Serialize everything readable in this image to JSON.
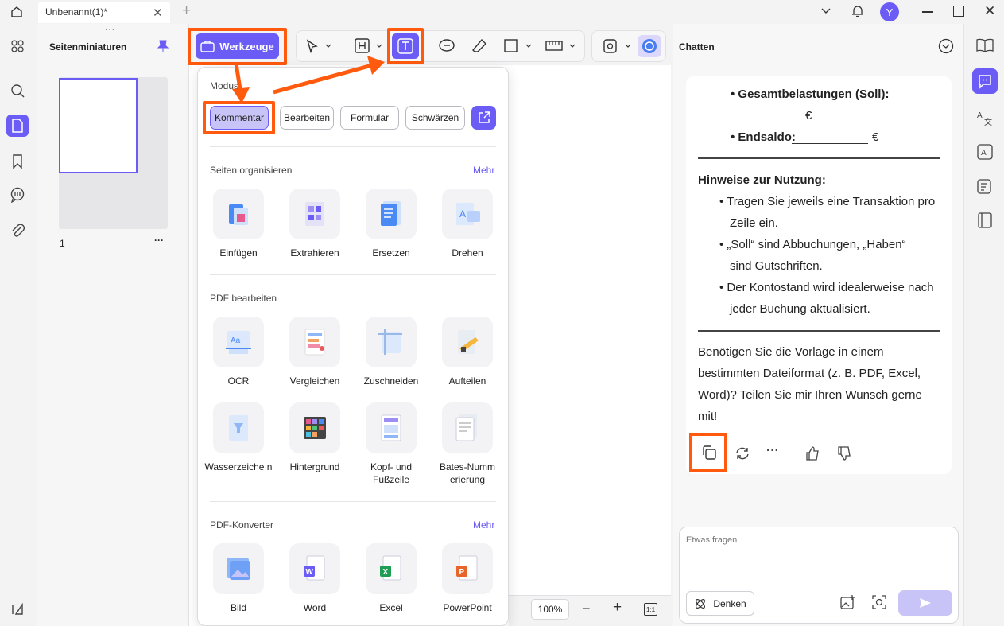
{
  "titlebar": {
    "tab_title": "Unbenannt(1)*",
    "avatar_letter": "Y"
  },
  "thumbnails": {
    "title": "Seitenminiaturen",
    "page_number": "1",
    "more": "···"
  },
  "toolbar": {
    "tools_label": "Werkzeuge",
    "zoom": "100%"
  },
  "menu": {
    "mode_title": "Modus",
    "modes": [
      "Kommentar",
      "Bearbeiten",
      "Formular",
      "Schwärzen"
    ],
    "sections": [
      {
        "title": "Seiten organisieren",
        "more": "Mehr",
        "items": [
          "Einfügen",
          "Extrahieren",
          "Ersetzen",
          "Drehen"
        ]
      },
      {
        "title": "PDF bearbeiten",
        "more": "",
        "items": [
          "OCR",
          "Vergleichen",
          "Zuschneiden",
          "Aufteilen",
          "Wasserzeiche n",
          "Hintergrund",
          "Kopf- und Fußzeile",
          "Bates-Numm erierung"
        ]
      },
      {
        "title": "PDF-Konverter",
        "more": "Mehr",
        "items": [
          "Bild",
          "Word",
          "Excel",
          "PowerPoint"
        ]
      }
    ]
  },
  "chat": {
    "title": "Chatten",
    "line_gesamt": "Gesamtbelastungen (Soll):",
    "line_endsaldo": "Endsaldo:",
    "euro": "€",
    "hinweise_title": "Hinweise zur Nutzung:",
    "bullets": [
      [
        "Tragen Sie jeweils eine Transaktion pro",
        "Zeile ein."
      ],
      [
        "„Soll“ sind Abbuchungen, „Haben“",
        "sind Gutschriften."
      ],
      [
        "Der Kontostand wird idealerweise nach",
        "jeder Buchung aktualisiert."
      ]
    ],
    "closing": [
      "Benötigen Sie die Vorlage in einem",
      "bestimmten Dateiformat (z. B. PDF, Excel,",
      "Word)? Teilen Sie mir Ihren Wunsch gerne",
      "mit!"
    ],
    "input_placeholder": "Etwas fragen",
    "think_label": "Denken"
  },
  "colors": {
    "accent": "#6b5cf6",
    "highlight": "#ff5a0e"
  }
}
